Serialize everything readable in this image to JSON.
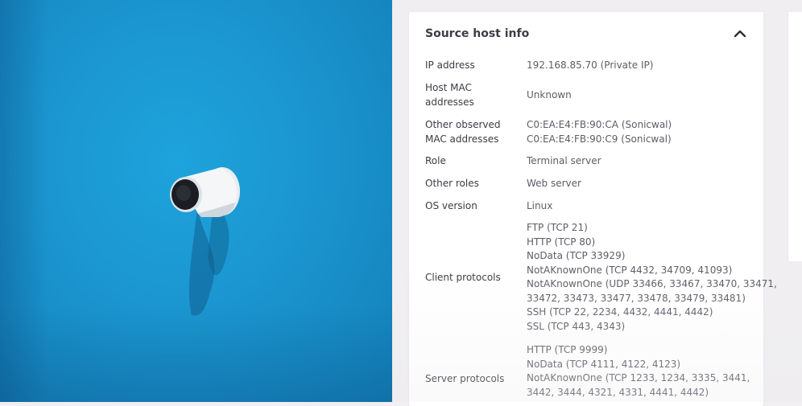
{
  "panel": {
    "title": "Source host info",
    "rows": [
      {
        "label": [
          "IP address"
        ],
        "values": [
          "192.168.85.70 (Private IP)"
        ]
      },
      {
        "label": [
          "Host MAC",
          "addresses"
        ],
        "values": [
          "Unknown"
        ]
      },
      {
        "label": [
          "Other observed",
          "MAC addresses"
        ],
        "values": [
          "C0:EA:E4:FB:90:CA (Sonicwal)",
          "C0:EA:E4:FB:90:C9 (Sonicwal)"
        ]
      },
      {
        "label": [
          "Role"
        ],
        "values": [
          "Terminal server"
        ]
      },
      {
        "label": [
          "Other roles"
        ],
        "values": [
          "Web server"
        ]
      },
      {
        "label": [
          "OS version"
        ],
        "values": [
          "Linux"
        ]
      },
      {
        "label": [
          "Client protocols"
        ],
        "values": [
          "FTP (TCP 21)",
          "HTTP (TCP 80)",
          "NoData (TCP 33929)",
          "NotAKnownOne (TCP 4432, 34709, 41093)",
          "NotAKnownOne (UDP 33466, 33467, 33470, 33471,",
          "33472, 33473, 33477, 33478, 33479, 33481)",
          "SSH (TCP 22, 2234, 4432, 4441, 4442)",
          "SSL (TCP 443, 4343)"
        ]
      },
      {
        "label": [
          "Server protocols"
        ],
        "values": [
          "HTTP (TCP 9999)",
          "NoData (TCP 4111, 4122, 4123)",
          "NotAKnownOne (TCP 1233, 1234, 3335, 3441,",
          "3442, 3444, 4321, 4331, 4441, 4442)"
        ]
      }
    ]
  }
}
